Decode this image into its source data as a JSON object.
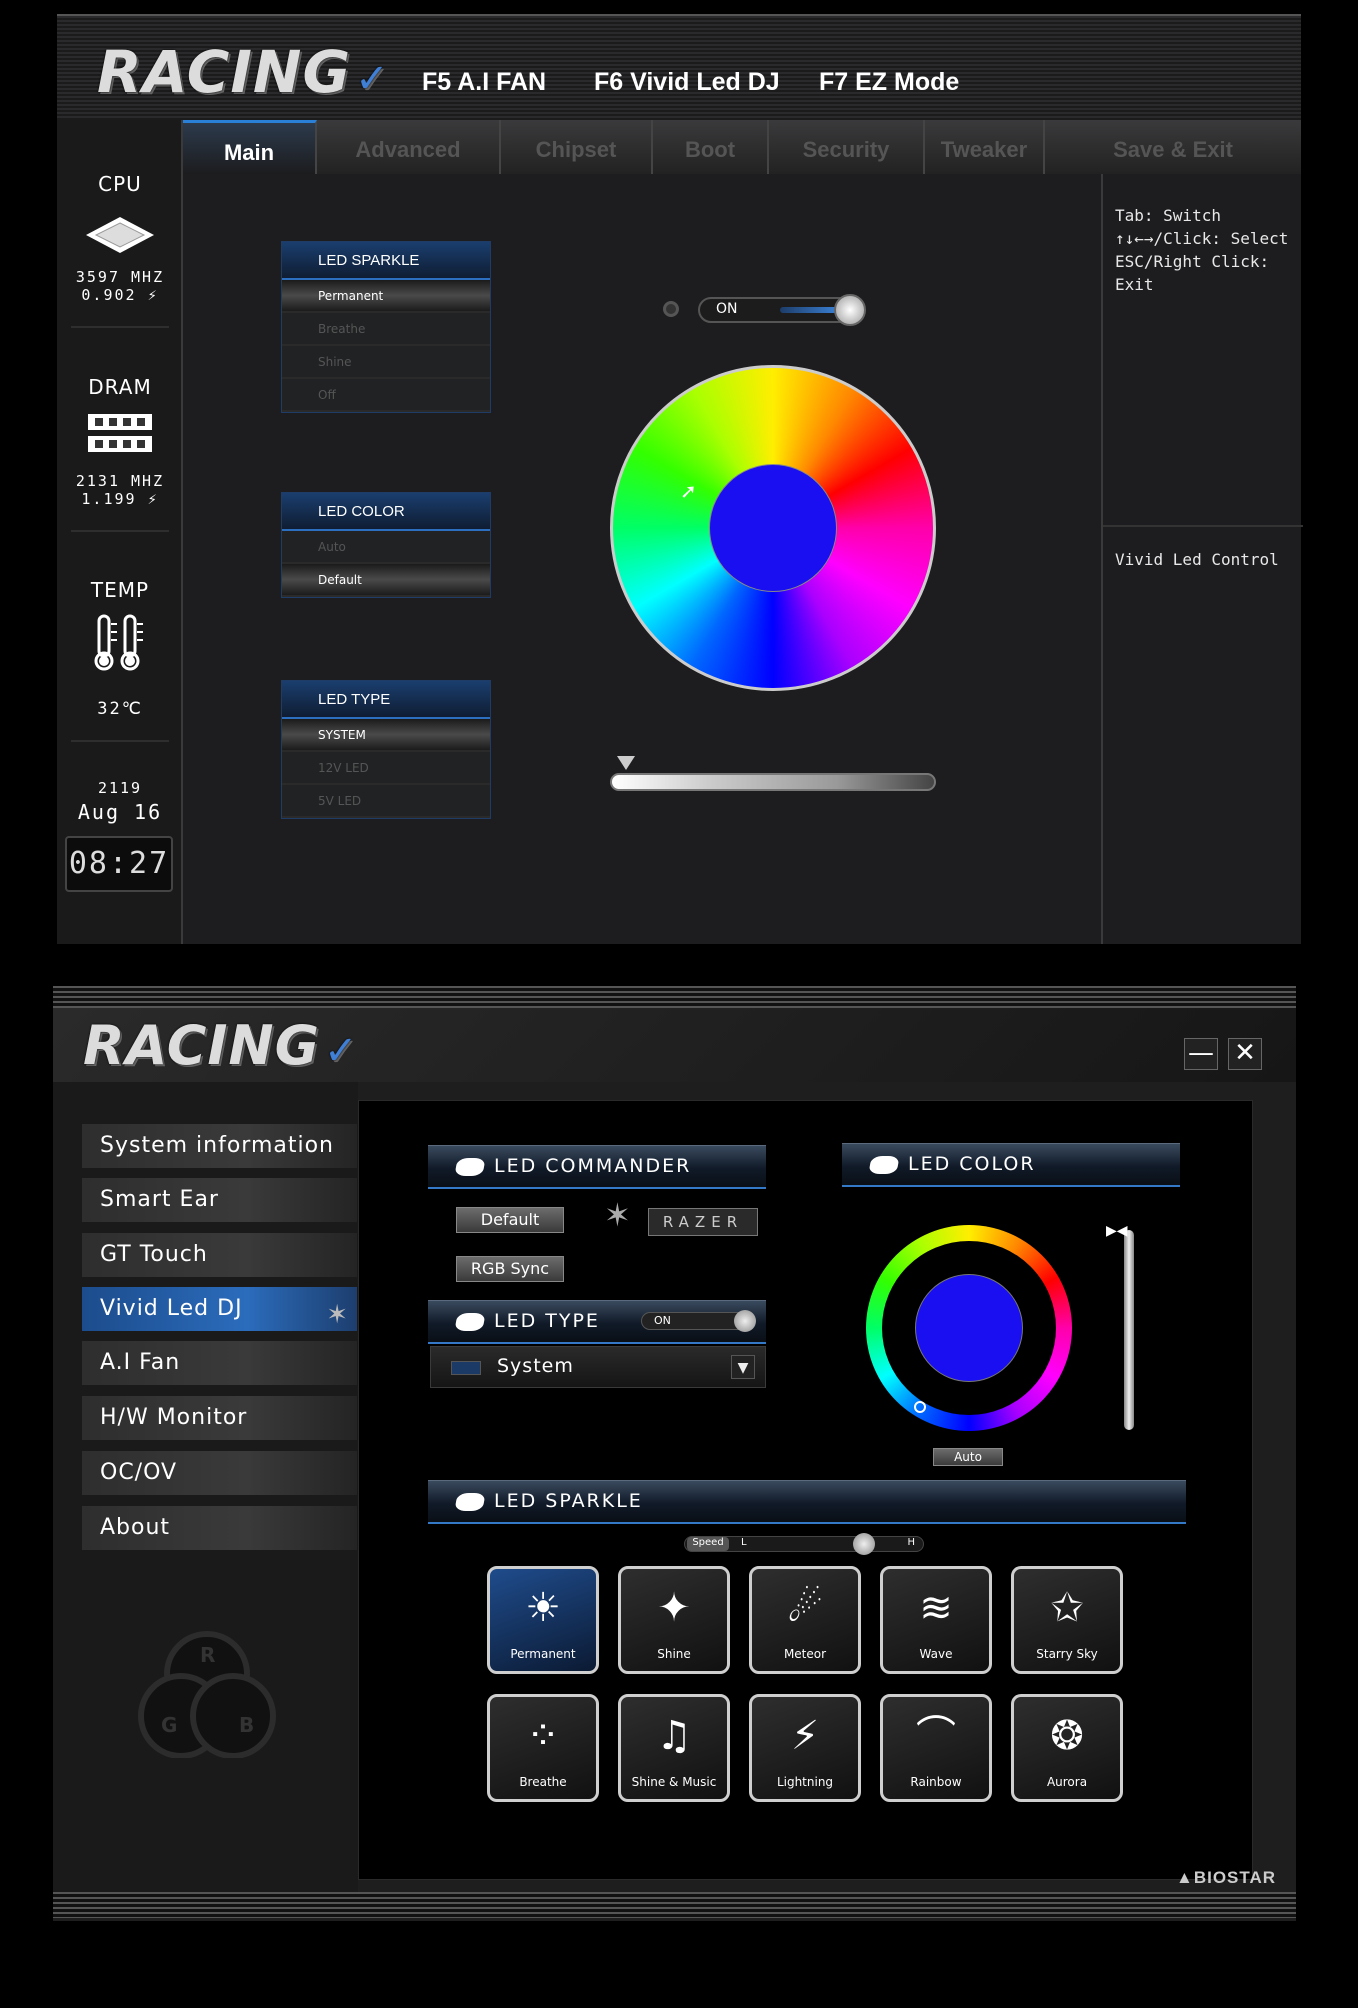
{
  "bios": {
    "logo": "RACING",
    "fkeys": [
      "F5 A.I FAN",
      "F6 Vivid Led DJ",
      "F7 EZ Mode"
    ],
    "tabs": [
      "Main",
      "Advanced",
      "Chipset",
      "Boot",
      "Security",
      "Tweaker",
      "Save & Exit"
    ],
    "active_tab": "Main",
    "sidebar": {
      "cpu_label": "CPU",
      "cpu_freq": "3597 MHZ",
      "cpu_volt": "0.902 ⚡",
      "dram_label": "DRAM",
      "dram_freq": "2131 MHZ",
      "dram_volt": "1.199 ⚡",
      "temp_label": "TEMP",
      "temp_value": "32℃",
      "year": "2119",
      "date": "Aug 16",
      "time": "08:27"
    },
    "help": {
      "line1": "Tab: Switch",
      "line2": "↑↓←→/Click: Select",
      "line3": "ESC/Right Click: Exit",
      "desc": "Vivid Led Control"
    },
    "led_sparkle": {
      "title": "LED SPARKLE",
      "options": [
        "Permanent",
        "Breathe",
        "Shine",
        "Off"
      ],
      "selected": "Permanent"
    },
    "led_color": {
      "title": "LED COLOR",
      "options": [
        "Auto",
        "Default"
      ],
      "selected": "Default"
    },
    "led_type": {
      "title": "LED TYPE",
      "options": [
        "SYSTEM",
        "12V LED",
        "5V LED"
      ],
      "selected": "SYSTEM"
    },
    "power_toggle": "ON",
    "center_color": "#1a0ff0"
  },
  "app": {
    "logo": "RACING",
    "minimize": "—",
    "close": "✕",
    "nav": [
      "System information",
      "Smart Ear",
      "GT Touch",
      "Vivid Led DJ",
      "A.I Fan",
      "H/W Monitor",
      "OC/OV",
      "About"
    ],
    "active_nav": "Vivid Led DJ",
    "rgb_letters": [
      "R",
      "G",
      "B"
    ],
    "led_commander": {
      "title": "LED COMMANDER",
      "default_btn": "Default",
      "rgb_sync_btn": "RGB Sync",
      "razer_label": "RAZER"
    },
    "led_type": {
      "title": "LED TYPE",
      "toggle": "ON",
      "dropdown_value": "System"
    },
    "led_color": {
      "title": "LED COLOR",
      "auto_btn": "Auto",
      "center_color": "#1a0ff0"
    },
    "led_sparkle": {
      "title": "LED SPARKLE",
      "speed_label": "Speed",
      "speed_low": "L",
      "speed_high": "H",
      "effects": [
        {
          "label": "Permanent",
          "icon": "sun-icon",
          "glyph": "☀"
        },
        {
          "label": "Shine",
          "icon": "sparkle-icon",
          "glyph": "✦"
        },
        {
          "label": "Meteor",
          "icon": "meteor-icon",
          "glyph": "☄"
        },
        {
          "label": "Wave",
          "icon": "wave-icon",
          "glyph": "≋"
        },
        {
          "label": "Starry Sky",
          "icon": "stars-icon",
          "glyph": "✩"
        },
        {
          "label": "Breathe",
          "icon": "breathe-icon",
          "glyph": "⁘"
        },
        {
          "label": "Shine & Music",
          "icon": "music-icon",
          "glyph": "♫"
        },
        {
          "label": "Lightning",
          "icon": "lightning-icon",
          "glyph": "⚡"
        },
        {
          "label": "Rainbow",
          "icon": "rainbow-icon",
          "glyph": "⌒"
        },
        {
          "label": "Aurora",
          "icon": "aurora-icon",
          "glyph": "❂"
        }
      ],
      "selected": "Permanent"
    },
    "brand": "BIOSTAR"
  }
}
